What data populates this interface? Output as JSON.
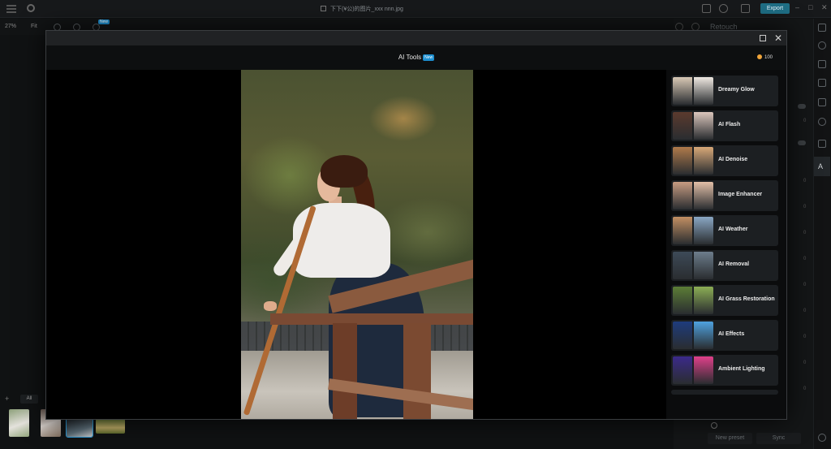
{
  "topbar": {
    "filename": "下下(¥公)的图片_xxx nnn.jpg",
    "export_label": "Export",
    "new_badge": "New"
  },
  "toolbar": {
    "zoom": "27%",
    "fit": "Fit"
  },
  "right_panel": {
    "title": "Retouch",
    "new_preset": "New preset",
    "sync": "Sync",
    "zero": "0"
  },
  "filmstrip": {
    "add": "+",
    "all_label": "All"
  },
  "modal": {
    "title": "AI Tools",
    "badge": "New",
    "credits": "100",
    "tools": [
      {
        "label": "Dreamy Glow",
        "colors": [
          "#d9c9b6",
          "#efe9e2"
        ]
      },
      {
        "label": "AI Flash",
        "colors": [
          "#5b3a2e",
          "#dcc7bd"
        ]
      },
      {
        "label": "AI Denoise",
        "colors": [
          "#b07a4b",
          "#d8a878"
        ]
      },
      {
        "label": "Image Enhancer",
        "colors": [
          "#c89c82",
          "#e3c0a8"
        ]
      },
      {
        "label": "AI Weather",
        "colors": [
          "#c28f63",
          "#8aa7c4"
        ]
      },
      {
        "label": "AI Removal",
        "colors": [
          "#3d4a58",
          "#6d7d8c"
        ]
      },
      {
        "label": "AI Grass Restoration",
        "colors": [
          "#5c7d36",
          "#8cae55"
        ]
      },
      {
        "label": "AI Effects",
        "colors": [
          "#1e3c7d",
          "#4fa2e0"
        ]
      },
      {
        "label": "Ambient Lighting",
        "colors": [
          "#3b2a8a",
          "#e0408a"
        ]
      }
    ]
  }
}
